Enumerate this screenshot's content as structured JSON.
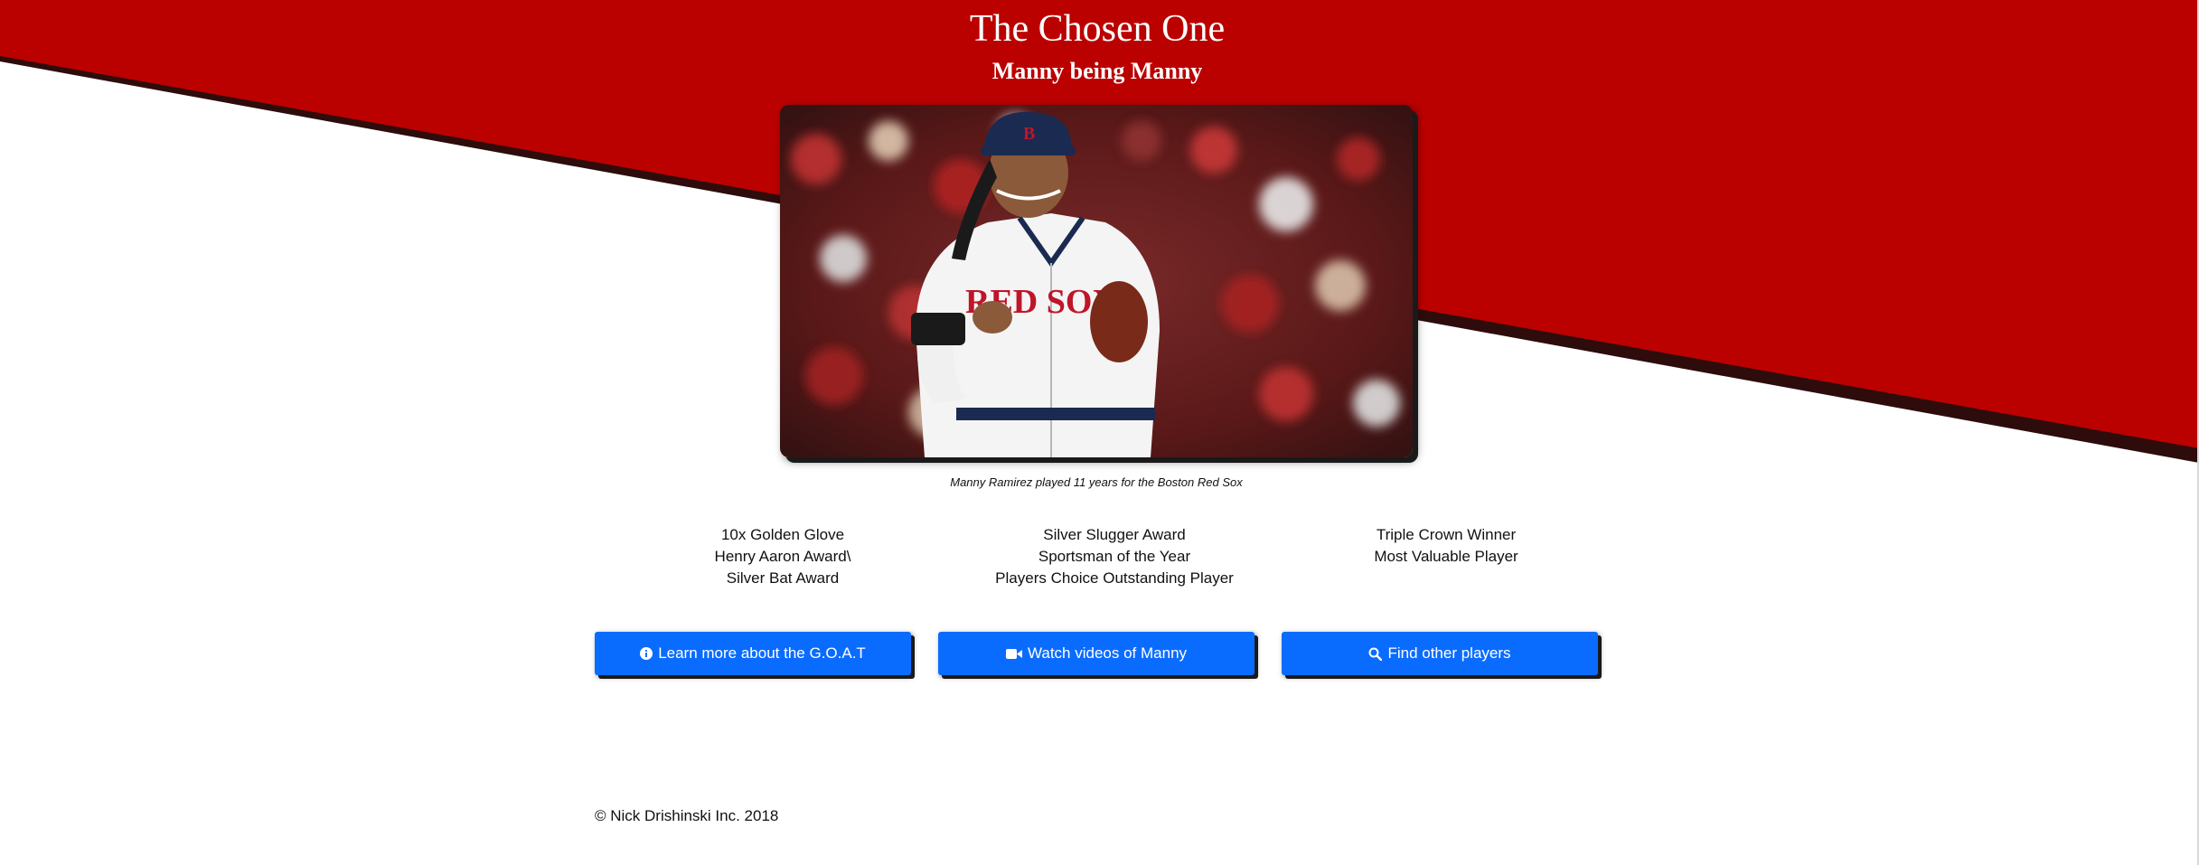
{
  "header": {
    "title": "The Chosen One",
    "subtitle": "Manny being Manny"
  },
  "photo": {
    "caption": "Manny Ramirez played 11 years for the Boston Red Sox",
    "jersey_text": "RED SOX"
  },
  "awards": {
    "column1": [
      "10x Golden Glove",
      "Henry Aaron Award\\",
      "Silver Bat Award"
    ],
    "column2": [
      "Silver Slugger Award",
      "Sportsman of the Year",
      "Players Choice Outstanding Player"
    ],
    "column3": [
      "Triple Crown Winner",
      "Most Valuable Player"
    ]
  },
  "buttons": {
    "learn": {
      "label": "Learn more about the G.O.A.T",
      "icon": "info-icon"
    },
    "videos": {
      "label": "Watch videos of Manny",
      "icon": "video-camera-icon"
    },
    "find": {
      "label": "Find other players",
      "icon": "search-icon"
    }
  },
  "footer": {
    "text": "© Nick Drishinski Inc. 2018"
  },
  "colors": {
    "banner_red": "#bb0000",
    "stripe_dark": "#2e0c0c",
    "button_blue": "#0a6cff"
  }
}
